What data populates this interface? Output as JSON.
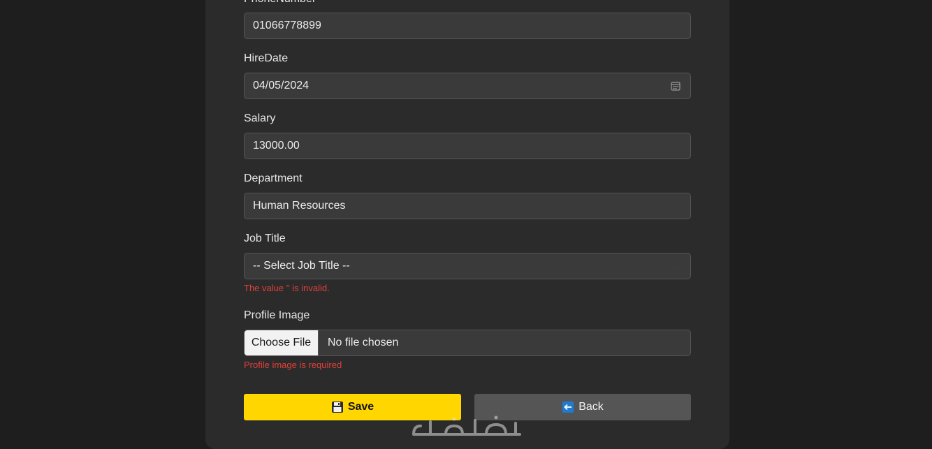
{
  "form": {
    "phone": {
      "label": "PhoneNumber",
      "value": "01066778899"
    },
    "hire_date": {
      "label": "HireDate",
      "value": "04/05/2024"
    },
    "salary": {
      "label": "Salary",
      "value": "13000.00"
    },
    "department": {
      "label": "Department",
      "value": "Human Resources"
    },
    "job_title": {
      "label": "Job Title",
      "value": "-- Select Job Title --",
      "error": "The value '' is invalid."
    },
    "profile_image": {
      "label": "Profile Image",
      "button": "Choose File",
      "status": "No file chosen",
      "error": "Profile image is required"
    }
  },
  "actions": {
    "save_label": "Save",
    "back_label": "Back"
  },
  "icons": {
    "hire_date": "calendar-icon",
    "job_title": "chevron-down-icon",
    "save": "floppy-disk-icon",
    "back": "left-arrow-icon"
  },
  "colors": {
    "save_bg": "#ffd600",
    "back_bg": "#555555",
    "error": "#e0403a",
    "card_bg": "#2b2b2b",
    "page_bg": "#1e1e1e"
  }
}
